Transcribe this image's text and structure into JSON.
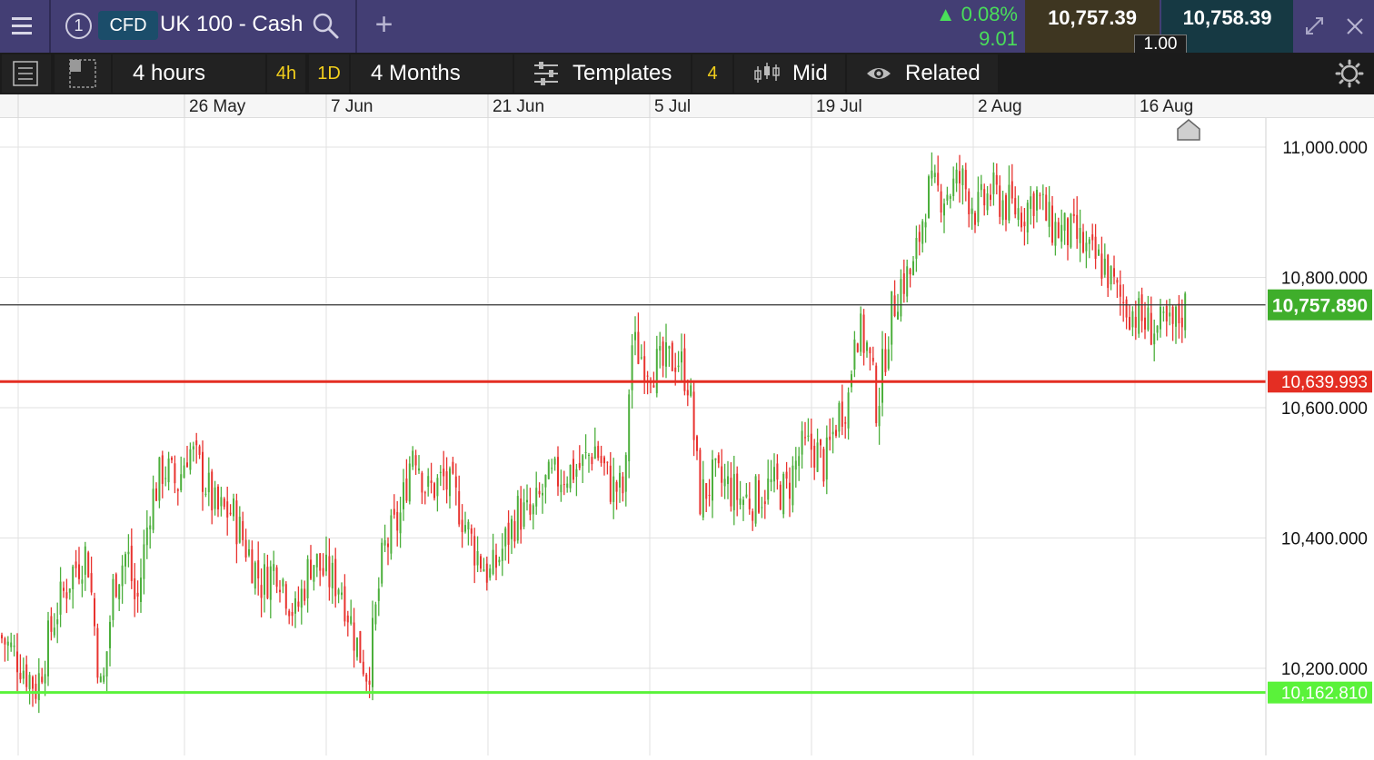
{
  "header": {
    "menu_icon": "hamburger-icon",
    "slot_number": "1",
    "instrument_type": "CFD",
    "instrument_name": "UK 100 - Cash",
    "search_icon": "magnifier-icon",
    "add_label": "+",
    "change_pct": "0.08%",
    "change_abs": "9.01",
    "change_arrow": "▲",
    "sell_price": "10,757.39",
    "buy_price": "10,758.39",
    "quantity": "1.00",
    "expand_icon": "expand-arrows-icon",
    "close_icon": "close-x-icon"
  },
  "toolbar": {
    "list_icon": "list-icon",
    "layout_icon": "layout-grid-icon",
    "interval": "4 hours",
    "quick_4h": "4h",
    "quick_1d": "1D",
    "range": "4 Months",
    "templates_icon": "sliders-icon",
    "templates": "Templates",
    "templates_count": "4",
    "price_type_icon": "candles-icon",
    "price_type": "Mid",
    "related_icon": "eye-icon",
    "related": "Related",
    "settings_icon": "gear-icon"
  },
  "colors": {
    "header_bg": "#433e74",
    "up": "#4caf3c",
    "down": "#e8332f",
    "current_line": "#333333",
    "current_label": "#3fae2b",
    "resistance": "#e42e23",
    "support": "#5af23a"
  },
  "chart_data": {
    "type": "candlestick",
    "x_tick_labels": [
      "26 May",
      "7 Jun",
      "21 Jun",
      "5 Jul",
      "19 Jul",
      "2 Aug",
      "16 Aug"
    ],
    "y_tick_labels": [
      "11,000.000",
      "10,800.000",
      "10,600.000",
      "10,400.000",
      "10,200.000"
    ],
    "y_ticks": [
      11000,
      10800,
      10600,
      10400,
      10200
    ],
    "ylim": [
      10100,
      11040
    ],
    "grid": true,
    "current_price": 10757.89,
    "current_price_label": "10,757.890",
    "resistance_level": 10639.993,
    "resistance_label": "10,639.993",
    "support_level": 10162.81,
    "support_label": "10,162.810",
    "price_path": [
      [
        0,
        10250
      ],
      [
        20,
        10215
      ],
      [
        40,
        10170
      ],
      [
        60,
        10280
      ],
      [
        80,
        10350
      ],
      [
        96,
        10380
      ],
      [
        112,
        10150
      ],
      [
        125,
        10330
      ],
      [
        140,
        10380
      ],
      [
        150,
        10290
      ],
      [
        165,
        10450
      ],
      [
        180,
        10510
      ],
      [
        195,
        10480
      ],
      [
        207,
        10540
      ],
      [
        222,
        10500
      ],
      [
        238,
        10440
      ],
      [
        255,
        10440
      ],
      [
        270,
        10390
      ],
      [
        288,
        10330
      ],
      [
        305,
        10360
      ],
      [
        325,
        10280
      ],
      [
        343,
        10370
      ],
      [
        360,
        10340
      ],
      [
        375,
        10330
      ],
      [
        392,
        10240
      ],
      [
        405,
        10190
      ],
      [
        422,
        10380
      ],
      [
        440,
        10430
      ],
      [
        455,
        10550
      ],
      [
        470,
        10470
      ],
      [
        488,
        10490
      ],
      [
        505,
        10450
      ],
      [
        520,
        10390
      ],
      [
        540,
        10340
      ],
      [
        555,
        10390
      ],
      [
        570,
        10440
      ],
      [
        585,
        10430
      ],
      [
        600,
        10480
      ],
      [
        620,
        10500
      ],
      [
        640,
        10510
      ],
      [
        655,
        10540
      ],
      [
        672,
        10480
      ],
      [
        688,
        10470
      ],
      [
        694,
        10700
      ],
      [
        712,
        10670
      ],
      [
        728,
        10660
      ],
      [
        745,
        10680
      ],
      [
        758,
        10640
      ],
      [
        770,
        10460
      ],
      [
        785,
        10490
      ],
      [
        800,
        10480
      ],
      [
        815,
        10460
      ],
      [
        830,
        10460
      ],
      [
        848,
        10480
      ],
      [
        865,
        10470
      ],
      [
        880,
        10530
      ],
      [
        895,
        10540
      ],
      [
        908,
        10510
      ],
      [
        922,
        10590
      ],
      [
        935,
        10620
      ],
      [
        940,
        10730
      ],
      [
        955,
        10690
      ],
      [
        965,
        10600
      ],
      [
        980,
        10740
      ],
      [
        990,
        10790
      ],
      [
        1005,
        10810
      ],
      [
        1020,
        10930
      ],
      [
        1040,
        10930
      ],
      [
        1058,
        10950
      ],
      [
        1075,
        10900
      ],
      [
        1090,
        10930
      ],
      [
        1110,
        10910
      ],
      [
        1125,
        10900
      ],
      [
        1140,
        10930
      ],
      [
        1155,
        10880
      ],
      [
        1170,
        10870
      ],
      [
        1185,
        10860
      ],
      [
        1200,
        10830
      ],
      [
        1215,
        10820
      ],
      [
        1230,
        10770
      ],
      [
        1245,
        10750
      ],
      [
        1260,
        10730
      ],
      [
        1275,
        10720
      ],
      [
        1290,
        10720
      ],
      [
        1305,
        10757.89
      ]
    ]
  }
}
